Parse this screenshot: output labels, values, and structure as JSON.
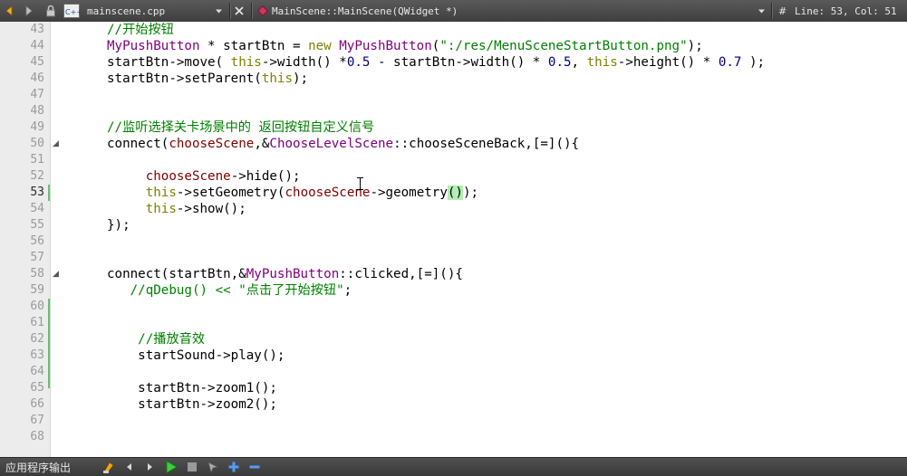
{
  "topbar": {
    "file_name": "mainscene.cpp",
    "symbol": "MainScene::MainScene(QWidget *)",
    "hash": "#",
    "position": "Line: 53, Col: 51",
    "file_type_icon_label": "C++"
  },
  "editor": {
    "lines": [
      {
        "num": "43",
        "segs": [
          {
            "t": "//开始按钮",
            "c": "cm"
          }
        ]
      },
      {
        "num": "44",
        "segs": [
          {
            "t": "MyPushButton",
            "c": "ty"
          },
          {
            "t": " * startBtn = ",
            "c": ""
          },
          {
            "t": "new",
            "c": "kw"
          },
          {
            "t": " ",
            "c": ""
          },
          {
            "t": "MyPushButton",
            "c": "ty"
          },
          {
            "t": "(",
            "c": ""
          },
          {
            "t": "\":/res/MenuSceneStartButton.png\"",
            "c": "st"
          },
          {
            "t": ");",
            "c": ""
          }
        ]
      },
      {
        "num": "45",
        "segs": [
          {
            "t": "startBtn->move( ",
            "c": ""
          },
          {
            "t": "this",
            "c": "kw"
          },
          {
            "t": "->width() *",
            "c": ""
          },
          {
            "t": "0.5",
            "c": "nm"
          },
          {
            "t": " - startBtn->width() * ",
            "c": ""
          },
          {
            "t": "0.5",
            "c": "nm"
          },
          {
            "t": ", ",
            "c": ""
          },
          {
            "t": "this",
            "c": "kw"
          },
          {
            "t": "->height() * ",
            "c": ""
          },
          {
            "t": "0.7",
            "c": "nm"
          },
          {
            "t": " );",
            "c": ""
          }
        ]
      },
      {
        "num": "46",
        "segs": [
          {
            "t": "startBtn->setParent(",
            "c": ""
          },
          {
            "t": "this",
            "c": "kw"
          },
          {
            "t": ");",
            "c": ""
          }
        ]
      },
      {
        "num": "47",
        "segs": []
      },
      {
        "num": "48",
        "segs": []
      },
      {
        "num": "49",
        "segs": [
          {
            "t": "//监听选择关卡场景中的 返回按钮自定义信号",
            "c": "cm"
          }
        ]
      },
      {
        "num": "50",
        "segs": [
          {
            "t": "connect(",
            "c": ""
          },
          {
            "t": "chooseScene",
            "c": "mv"
          },
          {
            "t": ",&",
            "c": ""
          },
          {
            "t": "ChooseLevelScene",
            "c": "ty"
          },
          {
            "t": "::chooseSceneBack,[=](){",
            "c": ""
          }
        ]
      },
      {
        "num": "51",
        "segs": []
      },
      {
        "num": "52",
        "segs": [
          {
            "t": "     ",
            "c": ""
          },
          {
            "t": "chooseScene",
            "c": "mv"
          },
          {
            "t": "->hide();",
            "c": ""
          }
        ]
      },
      {
        "num": "53",
        "segs": [
          {
            "t": "     ",
            "c": ""
          },
          {
            "t": "this",
            "c": "kw"
          },
          {
            "t": "->setGeometry(",
            "c": ""
          },
          {
            "t": "chooseScene",
            "c": "mv"
          },
          {
            "t": "->geometry",
            "c": ""
          },
          {
            "t": "()",
            "c": "paren-hl"
          },
          {
            "t": ");",
            "c": ""
          }
        ]
      },
      {
        "num": "54",
        "segs": [
          {
            "t": "     ",
            "c": ""
          },
          {
            "t": "this",
            "c": "kw"
          },
          {
            "t": "->show();",
            "c": ""
          }
        ]
      },
      {
        "num": "55",
        "segs": [
          {
            "t": "});",
            "c": ""
          }
        ]
      },
      {
        "num": "56",
        "segs": []
      },
      {
        "num": "57",
        "segs": []
      },
      {
        "num": "58",
        "segs": [
          {
            "t": "connect(startBtn,&",
            "c": ""
          },
          {
            "t": "MyPushButton",
            "c": "ty"
          },
          {
            "t": "::clicked,[=](){",
            "c": ""
          }
        ]
      },
      {
        "num": "59",
        "segs": [
          {
            "t": "   ",
            "c": ""
          },
          {
            "t": "//qDebug() << ",
            "c": "cm"
          },
          {
            "t": "\"点击了开始按钮\"",
            "c": "st"
          },
          {
            "t": ";",
            "c": ""
          }
        ]
      },
      {
        "num": "60",
        "segs": []
      },
      {
        "num": "61",
        "segs": []
      },
      {
        "num": "62",
        "segs": [
          {
            "t": "    ",
            "c": ""
          },
          {
            "t": "//播放音效",
            "c": "cm"
          }
        ]
      },
      {
        "num": "63",
        "segs": [
          {
            "t": "    startSound->play();",
            "c": ""
          }
        ]
      },
      {
        "num": "64",
        "segs": []
      },
      {
        "num": "65",
        "segs": [
          {
            "t": "    startBtn->zoom1();",
            "c": ""
          }
        ]
      },
      {
        "num": "66",
        "segs": [
          {
            "t": "    startBtn->zoom2();",
            "c": ""
          }
        ]
      },
      {
        "num": "67",
        "segs": []
      },
      {
        "num": "68",
        "segs": []
      }
    ]
  },
  "bottombar": {
    "panel_label": "应用程序输出"
  }
}
